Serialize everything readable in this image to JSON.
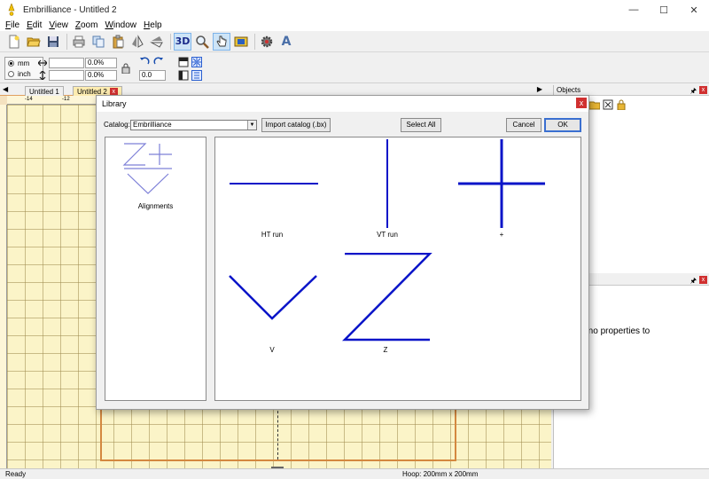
{
  "window": {
    "title": "Embrilliance - Untitled 2",
    "minimize": "—",
    "maximize": "☐",
    "close": "✕"
  },
  "menu": [
    {
      "label": "File",
      "accel": "F",
      "rest": "ile"
    },
    {
      "label": "Edit",
      "accel": "E",
      "rest": "dit"
    },
    {
      "label": "View",
      "accel": "V",
      "rest": "iew"
    },
    {
      "label": "Zoom",
      "accel": "Z",
      "rest": "oom"
    },
    {
      "label": "Window",
      "accel": "W",
      "rest": "indow"
    },
    {
      "label": "Help",
      "accel": "H",
      "rest": "elp"
    }
  ],
  "toolbar": {
    "three_d_label": "3D",
    "font_tool_label": "A"
  },
  "propbar": {
    "unit_mm": "mm",
    "unit_inch": "inch",
    "width_value": "",
    "height_value": "",
    "width_percent": "0.0%",
    "height_percent": "0.0%",
    "rotation_value": "0.0"
  },
  "tabs": [
    {
      "label": "Untitled 1",
      "current": false
    },
    {
      "label": "Untitled 2",
      "current": true
    }
  ],
  "ruler": {
    "marks": [
      "-14",
      "-12"
    ]
  },
  "objects_panel": {
    "title": "Objects",
    "pin": "🖈",
    "close": "x"
  },
  "properties_panel": {
    "pin": "🖈",
    "close": "x",
    "message": "re no properties to"
  },
  "status": {
    "left": "Ready",
    "hoop": "Hoop: 200mm x 200mm"
  },
  "library": {
    "title": "Library",
    "close": "x",
    "catalog_label": "Catalog:",
    "catalog_value": "Embrilliance",
    "import_button": "Import catalog (.bx)",
    "select_all_button": "Select All",
    "cancel_button": "Cancel",
    "ok_button": "OK",
    "categories": [
      {
        "label": "Alignments"
      }
    ],
    "items": [
      {
        "label": "HT run",
        "shape": "horizontal-line"
      },
      {
        "label": "VT run",
        "shape": "vertical-line"
      },
      {
        "label": "+",
        "shape": "cross"
      },
      {
        "label": "V",
        "shape": "v-shape"
      },
      {
        "label": "Z",
        "shape": "z-shape"
      }
    ],
    "stitch_color": "#0a14c8"
  }
}
